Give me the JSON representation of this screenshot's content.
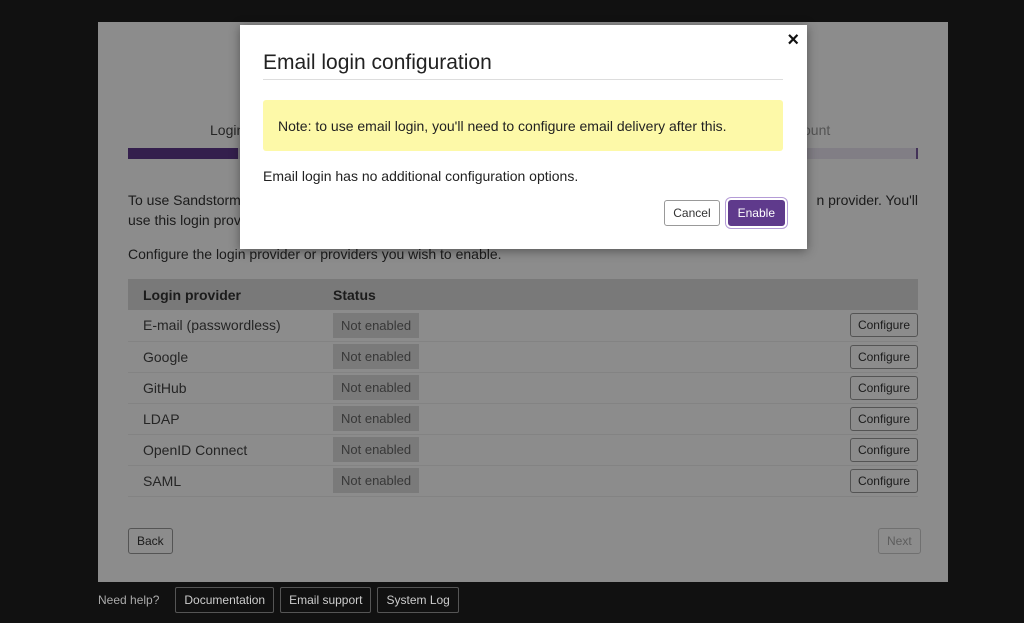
{
  "setup": {
    "step_login": "Login",
    "step_account": "ount",
    "intro_line1": "To use Sandstorm",
    "intro_line1_end": "n provider. You'll",
    "intro_line2": "use this login prov",
    "configure_text": "Configure the login provider or providers you wish to enable.",
    "table": {
      "headers": [
        "Login provider",
        "Status"
      ],
      "rows": [
        {
          "provider": "E-mail (passwordless)",
          "status": "Not enabled",
          "action": "Configure"
        },
        {
          "provider": "Google",
          "status": "Not enabled",
          "action": "Configure"
        },
        {
          "provider": "GitHub",
          "status": "Not enabled",
          "action": "Configure"
        },
        {
          "provider": "LDAP",
          "status": "Not enabled",
          "action": "Configure"
        },
        {
          "provider": "OpenID Connect",
          "status": "Not enabled",
          "action": "Configure"
        },
        {
          "provider": "SAML",
          "status": "Not enabled",
          "action": "Configure"
        }
      ]
    },
    "back_label": "Back",
    "next_label": "Next"
  },
  "footer": {
    "help_label": "Need help?",
    "links": [
      "Documentation",
      "Email support",
      "System Log"
    ]
  },
  "modal": {
    "title": "Email login configuration",
    "close_icon": "×",
    "note": "Note: to use email login, you'll need to configure email delivery after this.",
    "text": "Email login has no additional configuration options.",
    "cancel_label": "Cancel",
    "enable_label": "Enable"
  },
  "colors": {
    "accent": "#5f3a8c",
    "note_bg": "#fdf9a8"
  }
}
